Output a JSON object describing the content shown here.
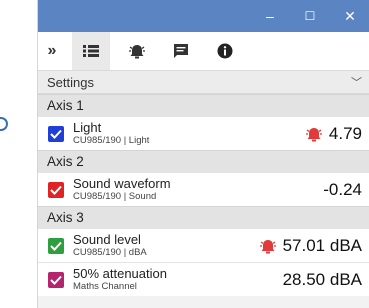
{
  "window": {
    "controls": {
      "minimize": "–",
      "maximize": "☐",
      "close": "✕"
    }
  },
  "toolbar": {
    "expand": "»",
    "buttons": [
      "list-icon",
      "alarm-icon",
      "notes-icon",
      "info-icon"
    ],
    "active": "list-icon"
  },
  "settings": {
    "label": "Settings",
    "chevron": "﹀"
  },
  "axes": [
    {
      "label": "Axis 1",
      "channels": [
        {
          "name": "Light",
          "sub": "CU985/190 | Light",
          "value": "4.79",
          "alarm": true,
          "checkbox_color": "#1f3fd6"
        }
      ]
    },
    {
      "label": "Axis 2",
      "channels": [
        {
          "name": "Sound waveform",
          "sub": "CU985/190 | Sound",
          "value": "-0.24",
          "alarm": false,
          "checkbox_color": "#e02424"
        }
      ]
    },
    {
      "label": "Axis 3",
      "channels": [
        {
          "name": "Sound level",
          "sub": "CU985/190 | dBA",
          "value": "57.01 dBA",
          "alarm": true,
          "checkbox_color": "#2e9e3e"
        },
        {
          "name": "50% attenuation",
          "sub": "Maths Channel",
          "value": "28.50 dBA",
          "alarm": false,
          "checkbox_color": "#b5246e"
        }
      ]
    }
  ],
  "colors": {
    "titlebar": "#5b85c2",
    "alarm": "#e03a3a"
  }
}
